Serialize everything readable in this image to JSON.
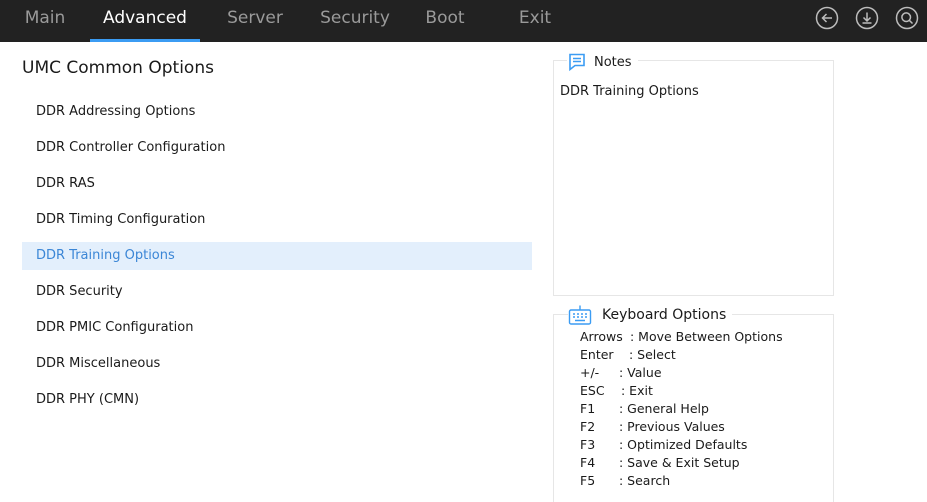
{
  "tabs": [
    {
      "label": "Main",
      "active": false
    },
    {
      "label": "Advanced",
      "active": true
    },
    {
      "label": "Server",
      "active": false
    },
    {
      "label": "Security",
      "active": false
    },
    {
      "label": "Boot",
      "active": false
    },
    {
      "label": "Exit",
      "active": false
    }
  ],
  "toolbar_icons": [
    "back-icon",
    "download-icon",
    "search-icon"
  ],
  "section_title": "UMC Common Options",
  "menu_items": [
    {
      "label": "DDR Addressing Options",
      "selected": false
    },
    {
      "label": "DDR Controller Configuration",
      "selected": false
    },
    {
      "label": "DDR RAS",
      "selected": false
    },
    {
      "label": "DDR Timing Configuration",
      "selected": false
    },
    {
      "label": "DDR Training Options",
      "selected": true
    },
    {
      "label": "DDR Security",
      "selected": false
    },
    {
      "label": "DDR PMIC Configuration",
      "selected": false
    },
    {
      "label": "DDR Miscellaneous",
      "selected": false
    },
    {
      "label": "DDR PHY (CMN)",
      "selected": false
    }
  ],
  "notes": {
    "title": "Notes",
    "icon": "notes-icon",
    "text": "DDR Training Options"
  },
  "keyboard": {
    "title": "Keyboard Options",
    "icon": "keyboard-icon",
    "rows": [
      {
        "key": "Arrows",
        "desc": ": Move Between Options"
      },
      {
        "key": "Enter",
        "desc": ": Select"
      },
      {
        "key": "+/-",
        "desc": ": Value"
      },
      {
        "key": "ESC",
        "desc": ": Exit"
      },
      {
        "key": "F1",
        "desc": ": General Help"
      },
      {
        "key": "F2",
        "desc": ": Previous Values"
      },
      {
        "key": "F3",
        "desc": ": Optimized Defaults"
      },
      {
        "key": "F4",
        "desc": ": Save & Exit Setup"
      },
      {
        "key": "F5",
        "desc": ": Search"
      }
    ]
  },
  "colors": {
    "topbar": "#222222",
    "accent": "#3b9cf3",
    "selected_bg": "#e3effc",
    "selected_text": "#3b86d6"
  }
}
